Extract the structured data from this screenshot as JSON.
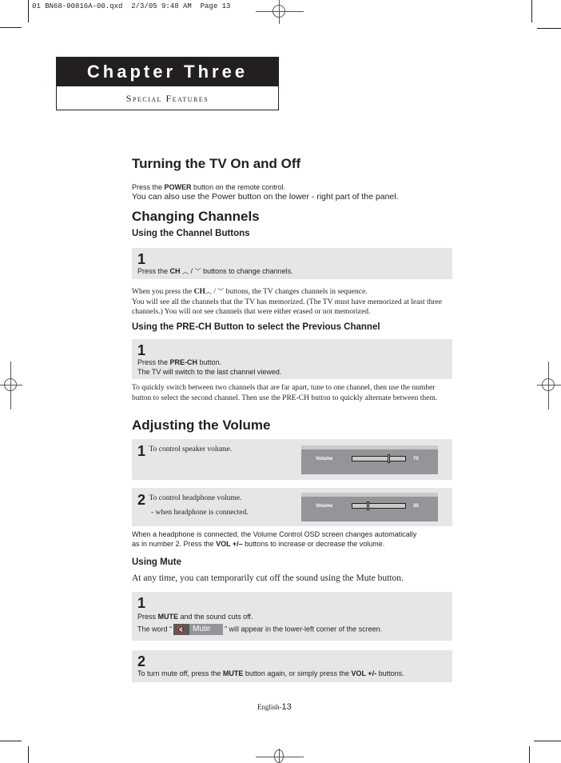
{
  "slug": "01 BN68-00816A-00.qxd  2/3/05 9:48 AM  Page 13",
  "chapter": {
    "title": "Chapter Three",
    "subtitle": "Special Features"
  },
  "sections": {
    "power": {
      "heading": "Turning the TV On and Off",
      "line1_pre": "Press the ",
      "line1_bold": "POWER",
      "line1_post": " button on the remote control.",
      "line2": "You can also use the Power button on the lower - right part of the panel."
    },
    "channels": {
      "heading": "Changing Channels",
      "sub1": "Using the Channel Buttons",
      "step1": {
        "num": "1",
        "pre": "Press the ",
        "bold": "CH",
        "up": "⌃",
        "sep": " / ",
        "down": "⌄",
        "post": " buttons to change channels."
      },
      "note1_pre": "When you press the ",
      "note1_bold": "CH",
      "note1_post": " buttons, the TV changes channels in sequence.",
      "note2": "You will see all the channels that the TV has memorized. (The TV must have  memorized at least three channels.) You will not see channels that were either erased or not memorized.",
      "sub2": "Using the PRE-CH Button to select the Previous Channel",
      "step2": {
        "num": "1",
        "pre": "Press the ",
        "bold": "PRE-CH",
        "post": " button.",
        "line2": "The TV will switch to the last channel viewed."
      },
      "note3": "To quickly switch between two channels that are far apart, tune to one channel, then use the number button to select the second channel. Then use the PRE-CH button to quickly alternate between them."
    },
    "volume": {
      "heading": "Adjusting the Volume",
      "step1": {
        "num": "1",
        "text": "To control speaker volume.",
        "osd_label": "Volume",
        "osd_value": "70",
        "level": 0.7
      },
      "step2": {
        "num": "2",
        "text": "To control headphone volume.",
        "text2": "- when headphone is connected.",
        "osd_label": "Volume",
        "osd_value": "30",
        "level": 0.3
      },
      "note_line1": "When a headphone is connected, the Volume Control OSD screen changes automatically",
      "note_line2_pre": "as in number 2. Press the ",
      "note_line2_bold": "VOL +/–",
      "note_line2_post": " buttons to increase or decrease the volume."
    },
    "mute": {
      "heading": "Using Mute",
      "intro": "At any time, you can temporarily cut off the sound using the Mute button.",
      "step1": {
        "num": "1",
        "pre": "Press ",
        "bold": "MUTE",
        "post": " and the sound cuts off.",
        "line2_pre": "The word  “",
        "badge_label": "Mute",
        "line2_post": "” will appear in the lower-left corner of the screen."
      },
      "step2": {
        "num": "2",
        "pre": "To turn mute off, press the ",
        "bold1": "MUTE",
        "mid": " button again, or simply press the ",
        "bold2": "VOL +/-",
        "post": " buttons."
      }
    }
  },
  "footer": {
    "prefix": "English-",
    "page": "13"
  }
}
